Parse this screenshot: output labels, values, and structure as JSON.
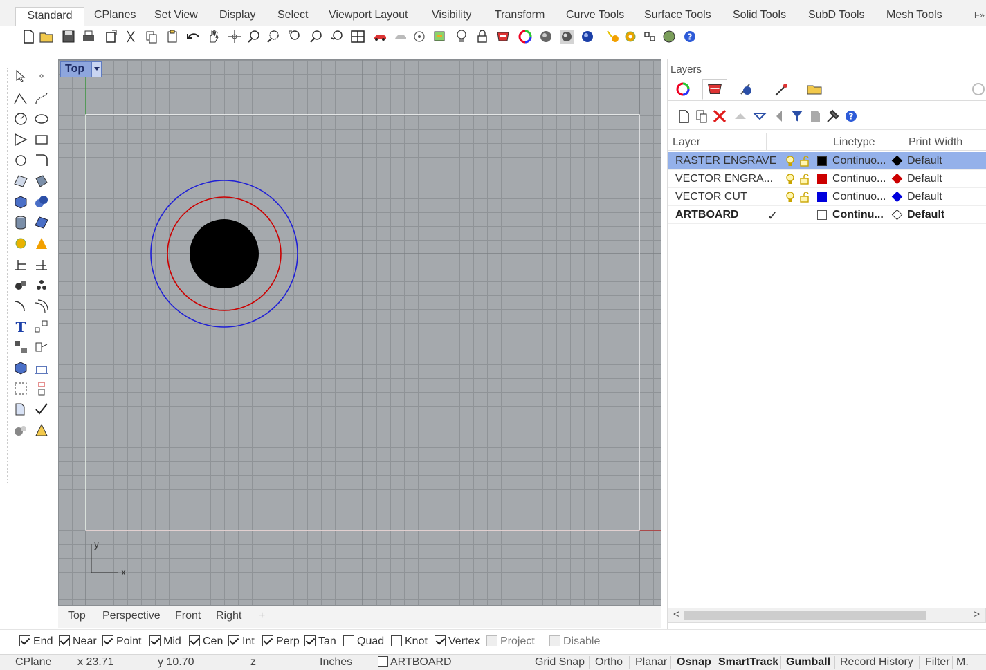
{
  "tabs": [
    {
      "label": "Standard",
      "active": true
    },
    {
      "label": "CPlanes"
    },
    {
      "label": "Set View"
    },
    {
      "label": "Display"
    },
    {
      "label": "Select"
    },
    {
      "label": "Viewport Layout"
    },
    {
      "label": "Visibility"
    },
    {
      "label": "Transform"
    },
    {
      "label": "Curve Tools"
    },
    {
      "label": "Surface Tools"
    },
    {
      "label": "Solid Tools"
    },
    {
      "label": "SubD Tools"
    },
    {
      "label": "Mesh Tools"
    }
  ],
  "tabs_more": "F»",
  "viewport": {
    "name": "Top",
    "axis_y": "y",
    "axis_x": "x",
    "tabs": [
      "Top",
      "Perspective",
      "Front",
      "Right"
    ],
    "add_tab": "+"
  },
  "osnap": [
    {
      "label": "End",
      "checked": true
    },
    {
      "label": "Near",
      "checked": true
    },
    {
      "label": "Point",
      "checked": true
    },
    {
      "label": "Mid",
      "checked": true
    },
    {
      "label": "Cen",
      "checked": true
    },
    {
      "label": "Int",
      "checked": true
    },
    {
      "label": "Perp",
      "checked": true
    },
    {
      "label": "Tan",
      "checked": true
    },
    {
      "label": "Quad",
      "checked": false
    },
    {
      "label": "Knot",
      "checked": false
    },
    {
      "label": "Vertex",
      "checked": true
    },
    {
      "label": "Project",
      "checked": false,
      "disabled": true
    },
    {
      "label": "Disable",
      "checked": false,
      "disabled": true
    }
  ],
  "status": {
    "cplane": "CPlane",
    "x": "x 23.71",
    "y": "y 10.70",
    "z": "z",
    "units": "Inches",
    "layer": "ARTBOARD",
    "grid_snap": "Grid Snap",
    "ortho": "Ortho",
    "planar": "Planar",
    "osnap": "Osnap",
    "smarttrack": "SmartTrack",
    "gumball": "Gumball",
    "record_history": "Record History",
    "filter": "Filter",
    "more": "M."
  },
  "layers_panel": {
    "title": "Layers",
    "columns": {
      "layer": "Layer",
      "linetype": "Linetype",
      "print_width": "Print Width"
    },
    "rows": [
      {
        "name": "RASTER ENGRAVE",
        "color": "#000000",
        "linetype": "Continuo...",
        "print_color": "#000000",
        "print_width": "Default",
        "selected": true,
        "current": false
      },
      {
        "name": "VECTOR ENGRA...",
        "color": "#cc0000",
        "linetype": "Continuo...",
        "print_color": "#cc0000",
        "print_width": "Default",
        "selected": false,
        "current": false
      },
      {
        "name": "VECTOR CUT",
        "color": "#0000dd",
        "linetype": "Continuo...",
        "print_color": "#0000dd",
        "print_width": "Default",
        "selected": false,
        "current": false
      },
      {
        "name": "ARTBOARD",
        "color": "#ffffff",
        "linetype": "Continu...",
        "print_color": "#ffffff",
        "print_width": "Default",
        "selected": false,
        "current": true,
        "current_mark": "✓"
      }
    ]
  },
  "colors": {
    "viewport_bg": "#a5a9ad",
    "raster": "#000000",
    "engrave": "#cc0000",
    "cut": "#1f1fd6",
    "selection": "#94b1ea"
  }
}
